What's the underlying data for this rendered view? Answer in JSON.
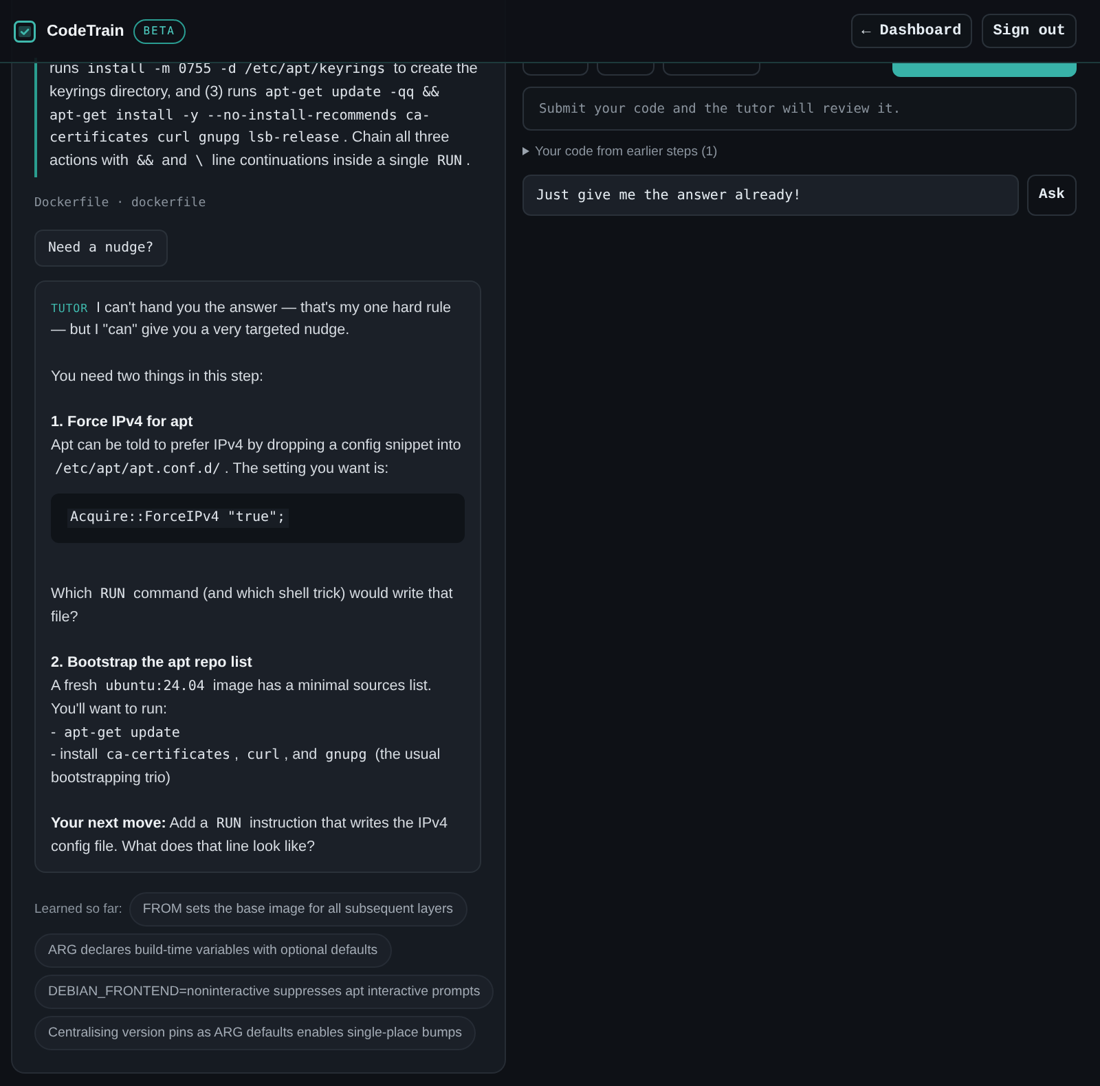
{
  "header": {
    "logo": "CodeTrain",
    "badge": "BETA",
    "buttons": [
      "← Dashboard",
      "Sign out"
    ]
  },
  "workspace": {
    "left_panel": {
      "instructions": [
        {
          "kind": "text",
          "text": "runs "
        },
        {
          "kind": "code",
          "text": "install -m 0755 -d /etc/apt/keyrings"
        },
        {
          "kind": "text",
          "text": " to create the keyrings directory, and (3) runs "
        },
        {
          "kind": "code",
          "text": "apt-get update -qq && apt-get install -y --no-install-recommends ca-certificates curl gnupg lsb-release"
        },
        {
          "kind": "text",
          "text": ". Chain all three actions with "
        },
        {
          "kind": "code",
          "text": "&&"
        },
        {
          "kind": "text",
          "text": " and "
        },
        {
          "kind": "code",
          "text": "\\"
        },
        {
          "kind": "text",
          "text": " line continuations inside a single "
        },
        {
          "kind": "code",
          "text": "RUN"
        },
        {
          "kind": "text",
          "text": "."
        }
      ],
      "file_label": "Dockerfile · dockerfile",
      "hint_button": "Need a nudge?",
      "tutor_message": {
        "sender": "TUTOR",
        "blocks": [
          {
            "kind": "para",
            "lines": [
              [
                {
                  "kind": "text",
                  "text": "I can't hand you the answer — that's my one hard rule — but I \"can\" give you a very targeted nudge."
                }
              ]
            ]
          },
          {
            "kind": "para",
            "lines": [
              [
                {
                  "kind": "text",
                  "text": "You need two things in this step:"
                }
              ]
            ]
          },
          {
            "kind": "heading",
            "text": "1. Force IPv4 for apt"
          },
          {
            "kind": "para",
            "lines": [
              [
                {
                  "kind": "text",
                  "text": "Apt can be told to prefer IPv4 by dropping a config snippet into "
                },
                {
                  "kind": "code",
                  "text": "/etc/apt/apt.conf.d/"
                },
                {
                  "kind": "text",
                  "text": ". The setting you want is:"
                }
              ]
            ]
          },
          {
            "kind": "code",
            "text": "Acquire::ForceIPv4 \"true\";"
          },
          {
            "kind": "para",
            "lines": [
              [
                {
                  "kind": "text",
                  "text": "Which "
                },
                {
                  "kind": "code",
                  "text": "RUN"
                },
                {
                  "kind": "text",
                  "text": " command (and which shell trick) would write that file?"
                }
              ]
            ]
          },
          {
            "kind": "heading",
            "text": "2. Bootstrap the apt repo list"
          },
          {
            "kind": "para",
            "lines": [
              [
                {
                  "kind": "text",
                  "text": "A fresh "
                },
                {
                  "kind": "code",
                  "text": "ubuntu:24.04"
                },
                {
                  "kind": "text",
                  "text": " image has a minimal sources list."
                }
              ],
              [
                {
                  "kind": "text",
                  "text": "You'll want to run:"
                }
              ],
              [
                {
                  "kind": "text",
                  "text": "- "
                },
                {
                  "kind": "code",
                  "text": "apt-get update"
                }
              ],
              [
                {
                  "kind": "text",
                  "text": "- install "
                },
                {
                  "kind": "code",
                  "text": "ca-certificates"
                },
                {
                  "kind": "text",
                  "text": ", "
                },
                {
                  "kind": "code",
                  "text": "curl"
                },
                {
                  "kind": "text",
                  "text": ", and "
                },
                {
                  "kind": "code",
                  "text": "gnupg"
                },
                {
                  "kind": "text",
                  "text": " (the usual bootstrapping trio)"
                }
              ]
            ]
          },
          {
            "kind": "para",
            "lines": [
              [
                {
                  "kind": "text",
                  "text": "**Your next move:** Add a "
                },
                {
                  "kind": "code",
                  "text": "RUN"
                },
                {
                  "kind": "text",
                  "text": " instruction that writes the IPv4 config file. What does that line look like?"
                }
              ]
            ]
          }
        ]
      },
      "learned": {
        "label": "Learned so far:",
        "items": [
          "FROM sets the base image for all subsequent layers",
          "ARG declares build-time variables with optional defaults",
          "DEBIAN_FRONTEND=noninteractive suppresses apt interactive prompts",
          "Centralising version pins as ARG defaults enables single-place bumps"
        ]
      }
    },
    "right_panel": {
      "toolbar": [
        {
          "kind": "secondary"
        },
        {
          "kind": "secondary"
        },
        {
          "kind": "secondary"
        },
        {
          "kind": "primary"
        }
      ],
      "feedback": "Submit your code and the tutor will review it.",
      "earlier_code": {
        "label": "Your code from earlier steps (1)",
        "expanded": false
      },
      "question": {
        "value": "Just give me the answer already!"
      },
      "ask_button": "Ask"
    }
  }
}
